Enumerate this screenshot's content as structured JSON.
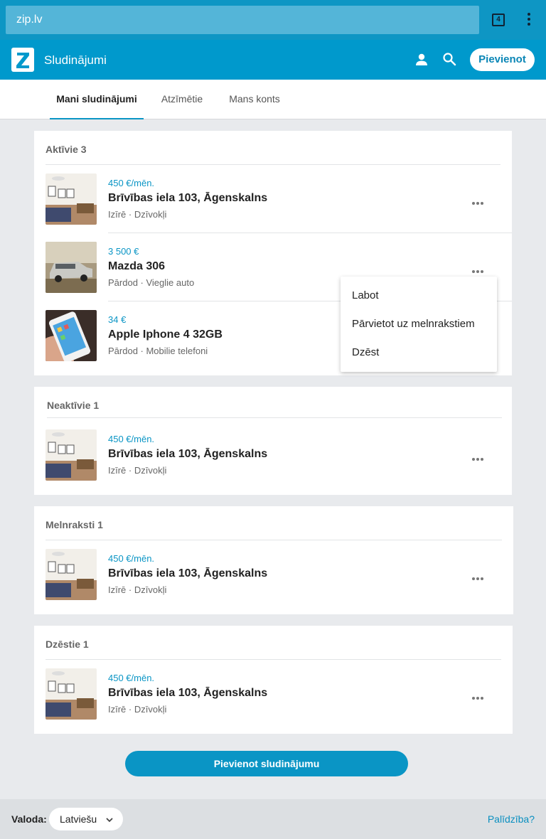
{
  "browser": {
    "url": "zip.lv",
    "tab_count": "4"
  },
  "header": {
    "title": "Sludinājumi",
    "add_label": "Pievienot"
  },
  "tabs": [
    {
      "label": "Mani sludinājumi",
      "active": true
    },
    {
      "label": "Atzīmētie",
      "active": false
    },
    {
      "label": "Mans konts",
      "active": false
    }
  ],
  "sections": [
    {
      "heading": "Aktīvie 3",
      "items": [
        {
          "price": "450 €/mēn.",
          "title": "Brīvības iela 103, Āgenskalns",
          "meta": "Izīrē · Dzīvokļi",
          "thumb": "apartment-photo"
        },
        {
          "price": "3 500 €",
          "title": "Mazda 306",
          "meta": "Pārdod · Vieglie auto",
          "thumb": "car-photo"
        },
        {
          "price": "34 €",
          "title": "Apple Iphone 4 32GB",
          "meta": "Pārdod · Mobilie telefoni",
          "thumb": "phone-photo"
        }
      ]
    },
    {
      "heading": "Neaktīvie 1",
      "items": [
        {
          "price": "450 €/mēn.",
          "title": "Brīvības iela 103, Āgenskalns",
          "meta": "Izīrē · Dzīvokļi",
          "thumb": "apartment-photo"
        }
      ]
    },
    {
      "heading": "Melnraksti 1",
      "items": [
        {
          "price": "450 €/mēn.",
          "title": "Brīvības iela 103, Āgenskalns",
          "meta": "Izīrē · Dzīvokļi",
          "thumb": "apartment-photo"
        }
      ]
    },
    {
      "heading": "Dzēstie 1",
      "items": [
        {
          "price": "450 €/mēn.",
          "title": "Brīvības iela 103, Āgenskalns",
          "meta": "Izīrē · Dzīvokļi",
          "thumb": "apartment-photo"
        }
      ]
    }
  ],
  "context_menu": {
    "items": [
      "Labot",
      "Pārvietot uz melnrakstiem",
      "Dzēst"
    ]
  },
  "add_ad_button": "Pievienot sludinājumu",
  "footer": {
    "language_label": "Valoda:",
    "language_value": "Latviešu",
    "help": "Palīdzība?"
  },
  "colors": {
    "brand": "#0099cc",
    "accent": "#0a95c5",
    "background": "#e8eaed"
  }
}
